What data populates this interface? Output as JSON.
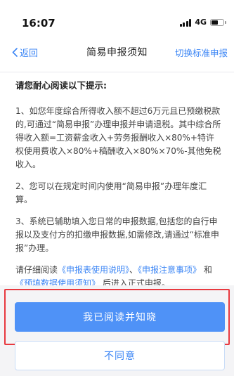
{
  "status_bar": {
    "time": "16:07",
    "network": "4G"
  },
  "nav": {
    "back_label": "返回",
    "title": "简易申报须知",
    "action_label": "切换标准申报"
  },
  "content": {
    "heading": "请您耐心阅读以下提示:",
    "para1": "1、如您年度综合所得收入额不超过6万元且已预缴税款的,可通过“简易申报”办理申报并申请退税。其中综合所得收入额=工资薪金收入+劳务报酬收入×80%+特许权使用费收入×80%+稿酬收入×80%×70%-其他免税收入。",
    "para2": "2、您可以在规定时间内使用“简易申报”办理年度汇算。",
    "para3": "3、系统已辅助填入您日常的申报数据,包括您的自行申报以及支付方的扣缴申报数据,如需修改,请通过“标准申报”办理。",
    "para4_prefix": "请仔细阅读",
    "link1": "《申报表使用说明》",
    "sep1": "、",
    "link2": "《申报注意事项》",
    "sep2": "和",
    "link3": "《预填数据使用须知》",
    "para4_suffix": "后进入正式申报。"
  },
  "buttons": {
    "agree_label": "我已阅读并知晓",
    "disagree_label": "不同意"
  },
  "colors": {
    "accent": "#3c86f5",
    "primary_button": "#4f92f7",
    "highlight": "#e8393f"
  }
}
